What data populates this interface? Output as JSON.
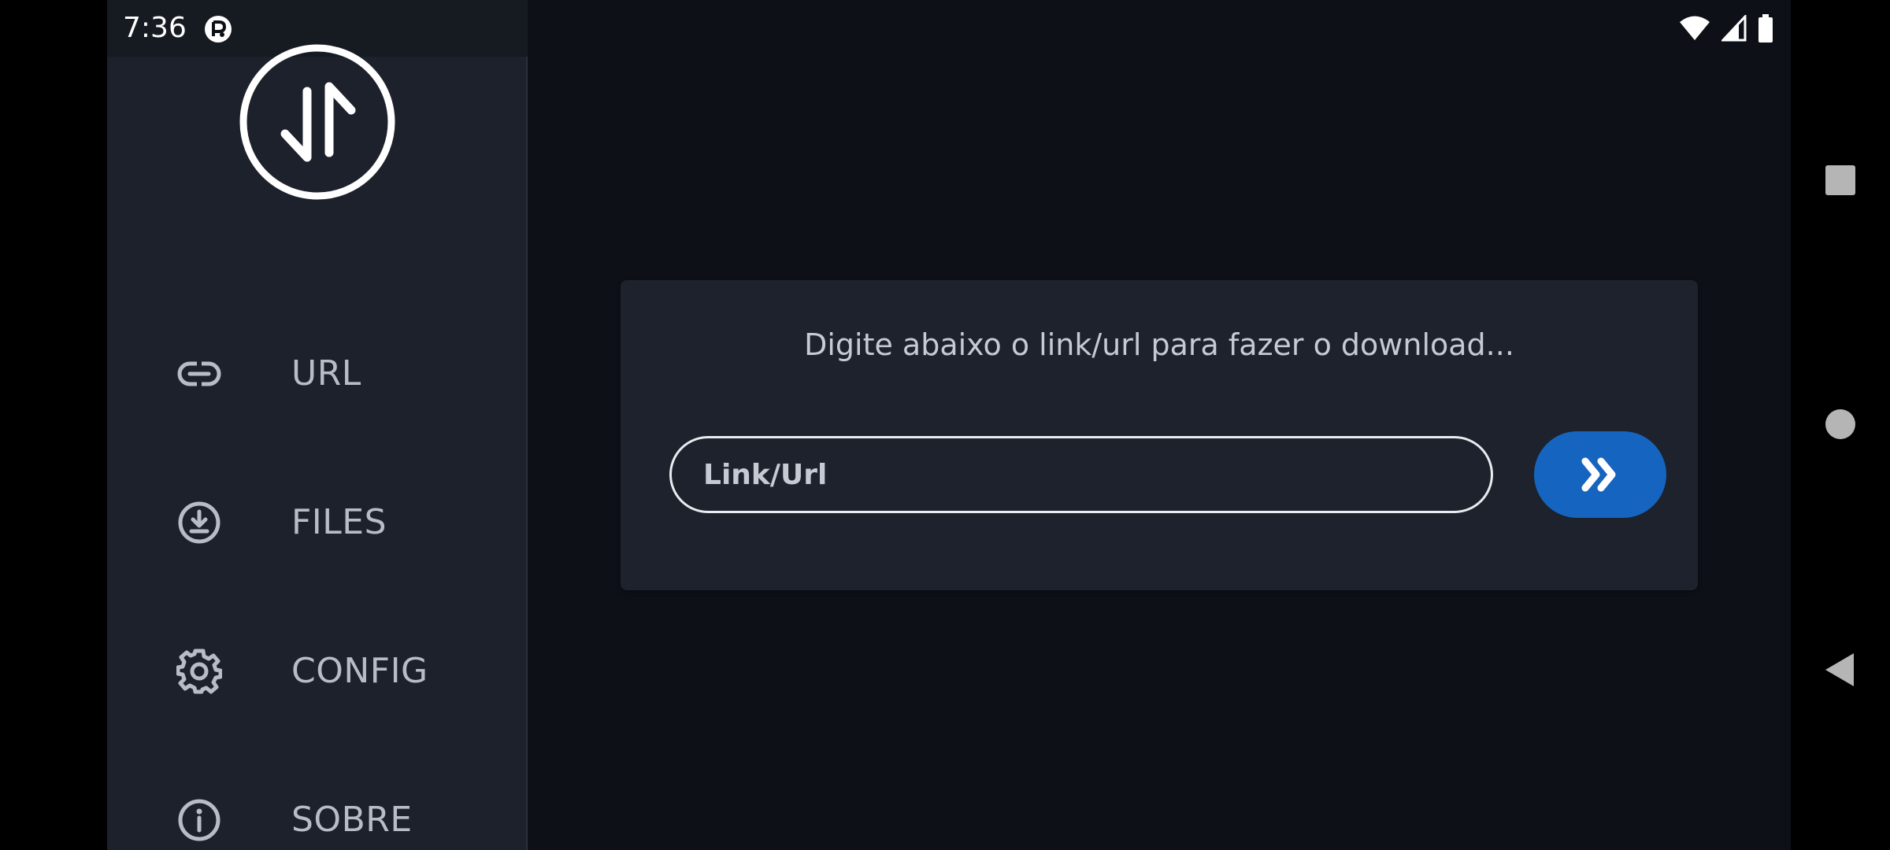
{
  "status_bar": {
    "time": "7:36",
    "icons": [
      "app-notification-icon",
      "wifi-icon",
      "signal-icon",
      "battery-icon"
    ]
  },
  "sidebar": {
    "logo_icon": "download-upload-arrows-icon",
    "items": [
      {
        "label": "URL",
        "icon": "link-icon"
      },
      {
        "label": "FILES",
        "icon": "download-circle-icon"
      },
      {
        "label": "CONFIG",
        "icon": "gear-icon"
      },
      {
        "label": "SOBRE",
        "icon": "info-icon"
      }
    ]
  },
  "main": {
    "prompt": "Digite abaixo o link/url para fazer o download...",
    "input": {
      "value": "",
      "placeholder": "Link/Url"
    },
    "submit_icon": "double-chevron-right-icon"
  },
  "system_nav": {
    "buttons": [
      "recents-icon",
      "home-icon",
      "back-icon"
    ]
  },
  "colors": {
    "background": "#0d1117",
    "sidebar": "#1c212b",
    "card": "#1d222c",
    "accent": "#1565c0",
    "text": "#c5cad3"
  }
}
